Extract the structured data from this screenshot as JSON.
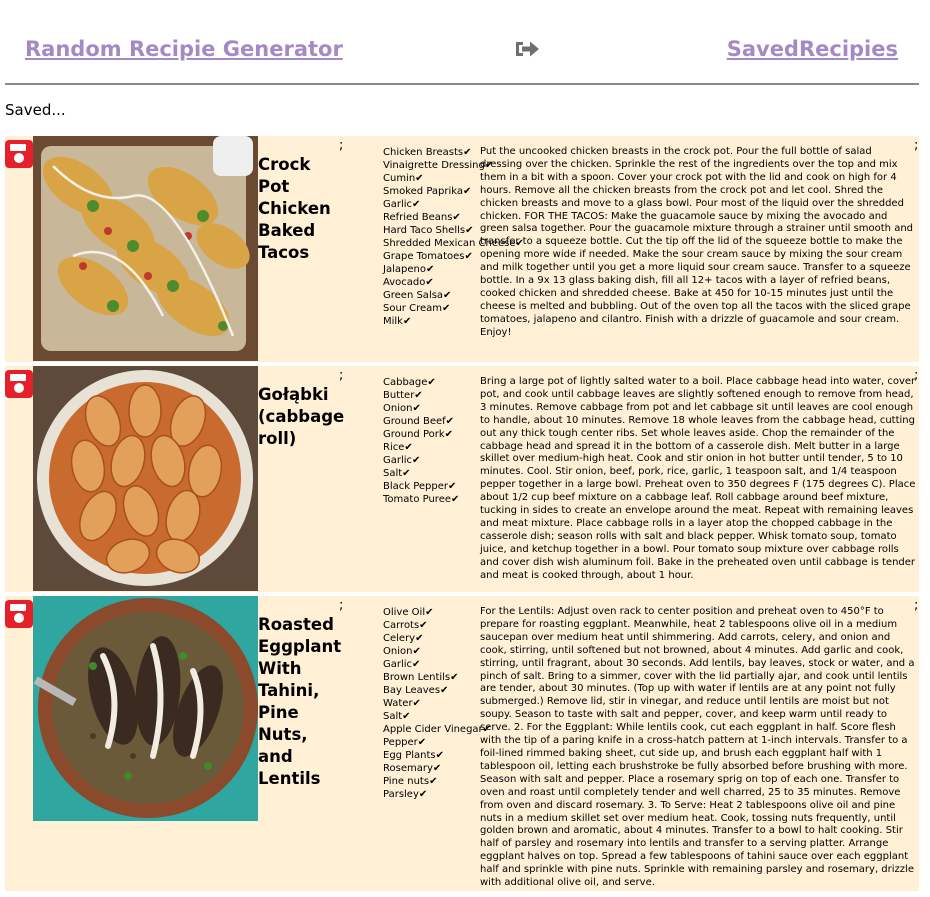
{
  "header": {
    "home_label": "Random Recipie Generator",
    "saved_label": "SavedRecipies",
    "signout_icon": "sign-out-icon",
    "link_color": "#a589c4"
  },
  "saved_heading": "Saved...",
  "card_background": "#fff0d6",
  "save_icon_color": "#e5202a",
  "recipes": [
    {
      "title": "Crock Pot Chicken Baked Tacos",
      "separator_a": ";",
      "separator_b": ";",
      "ingredients": [
        "Chicken Breasts✔",
        "Vinaigrette Dressing✔",
        "Cumin✔",
        "Smoked Paprika✔",
        "Garlic✔",
        "Refried Beans✔",
        "Hard Taco Shells✔",
        "Shredded Mexican Cheese✔",
        "Grape Tomatoes✔",
        "Jalapeno✔",
        "Avocado✔",
        "Green Salsa✔",
        "Sour Cream✔",
        "Milk✔"
      ],
      "instructions": "Put the uncooked chicken breasts in the crock pot. Pour the full bottle of salad dressing over the chicken. Sprinkle the rest of the ingredients over the top and mix them in a bit with a spoon. Cover your crock pot with the lid and cook on high for 4 hours. Remove all the chicken breasts from the crock pot and let cool. Shred the chicken breasts and move to a glass bowl. Pour most of the liquid over the shredded chicken. FOR THE TACOS: Make the guacamole sauce by mixing the avocado and green salsa together. Pour the guacamole mixture through a strainer until smooth and transfer to a squeeze bottle. Cut the tip off the lid of the squeeze bottle to make the opening more wide if needed. Make the sour cream sauce by mixing the sour cream and milk together until you get a more liquid sour cream sauce. Transfer to a squeeze bottle. In a 9x 13 glass baking dish, fill all 12+ tacos with a layer of refried beans, cooked chicken and shredded cheese. Bake at 450 for 10-15 minutes just until the cheese is melted and bubbling. Out of the oven top all the tacos with the sliced grape tomatoes, jalapeno and cilantro. Finish with a drizzle of guacamole and sour cream. Enjoy!"
    },
    {
      "title": "Gołąbki (cabbage roll)",
      "separator_a": ";",
      "separator_b": ";",
      "ingredients": [
        "Cabbage✔",
        "Butter✔",
        "Onion✔",
        "Ground Beef✔",
        "Ground Pork✔",
        "Rice✔",
        "Garlic✔",
        "Salt✔",
        "Black Pepper✔",
        "Tomato Puree✔"
      ],
      "instructions": "Bring a large pot of lightly salted water to a boil. Place cabbage head into water, cover pot, and cook until cabbage leaves are slightly softened enough to remove from head, 3 minutes. Remove cabbage from pot and let cabbage sit until leaves are cool enough to handle, about 10 minutes. Remove 18 whole leaves from the cabbage head, cutting out any thick tough center ribs. Set whole leaves aside. Chop the remainder of the cabbage head and spread it in the bottom of a casserole dish. Melt butter in a large skillet over medium-high heat. Cook and stir onion in hot butter until tender, 5 to 10 minutes. Cool. Stir onion, beef, pork, rice, garlic, 1 teaspoon salt, and 1/4 teaspoon pepper together in a large bowl. Preheat oven to 350 degrees F (175 degrees C). Place about 1/2 cup beef mixture on a cabbage leaf. Roll cabbage around beef mixture, tucking in sides to create an envelope around the meat. Repeat with remaining leaves and meat mixture. Place cabbage rolls in a layer atop the chopped cabbage in the casserole dish; season rolls with salt and black pepper. Whisk tomato soup, tomato juice, and ketchup together in a bowl. Pour tomato soup mixture over cabbage rolls and cover dish wish aluminum foil. Bake in the preheated oven until cabbage is tender and meat is cooked through, about 1 hour."
    },
    {
      "title": "Roasted Eggplant With Tahini, Pine Nuts, and Lentils",
      "separator_a": ";",
      "separator_b": ";",
      "ingredients": [
        "Olive Oil✔",
        "Carrots✔",
        "Celery✔",
        "Onion✔",
        "Garlic✔",
        "Brown Lentils✔",
        "Bay Leaves✔",
        "Water✔",
        "Salt✔",
        "Apple Cider Vinegar✔",
        "Pepper✔",
        "Egg Plants✔",
        "Rosemary✔",
        "Pine nuts✔",
        "Parsley✔"
      ],
      "instructions": "For the Lentils: Adjust oven rack to center position and preheat oven to 450°F to prepare for roasting eggplant. Meanwhile, heat 2 tablespoons olive oil in a medium saucepan over medium heat until shimmering. Add carrots, celery, and onion and cook, stirring, until softened but not browned, about 4 minutes. Add garlic and cook, stirring, until fragrant, about 30 seconds. Add lentils, bay leaves, stock or water, and a pinch of salt. Bring to a simmer, cover with the lid partially ajar, and cook until lentils are tender, about 30 minutes. (Top up with water if lentils are at any point not fully submerged.) Remove lid, stir in vinegar, and reduce until lentils are moist but not soupy. Season to taste with salt and pepper, cover, and keep warm until ready to serve. 2. For the Eggplant: While lentils cook, cut each eggplant in half. Score flesh with the tip of a paring knife in a cross-hatch pattern at 1-inch intervals. Transfer to a foil-lined rimmed baking sheet, cut side up, and brush each eggplant half with 1 tablespoon oil, letting each brushstroke be fully absorbed before brushing with more. Season with salt and pepper. Place a rosemary sprig on top of each one. Transfer to oven and roast until completely tender and well charred, 25 to 35 minutes. Remove from oven and discard rosemary. 3. To Serve: Heat 2 tablespoons olive oil and pine nuts in a medium skillet set over medium heat. Cook, tossing nuts frequently, until golden brown and aromatic, about 4 minutes. Transfer to a bowl to halt cooking. Stir half of parsley and rosemary into lentils and transfer to a serving platter. Arrange eggplant halves on top. Spread a few tablespoons of tahini sauce over each eggplant half and sprinkle with pine nuts. Sprinkle with remaining parsley and rosemary, drizzle with additional olive oil, and serve."
    }
  ]
}
